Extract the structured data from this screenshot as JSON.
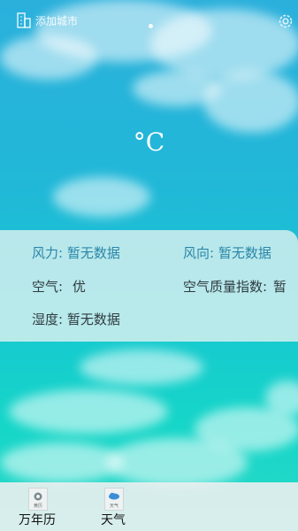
{
  "header": {
    "add_city_label": "添加城市"
  },
  "weather": {
    "temperature_unit": "°C"
  },
  "details": {
    "wind_force_label": "风力:",
    "wind_force_value": "暂无数据",
    "wind_direction_label": "风向:",
    "wind_direction_value": "暂无数据",
    "air_label": "空气:",
    "air_value": "优",
    "aqi_label": "空气质量指数:",
    "aqi_value": "暂",
    "humidity_label": "湿度:",
    "humidity_value": "暂无数据"
  },
  "tabs": [
    {
      "label": "万年历",
      "icon_text": "黄历",
      "icon": "calendar-icon"
    },
    {
      "label": "天气",
      "icon_text": "天气",
      "icon": "weather-icon"
    }
  ]
}
